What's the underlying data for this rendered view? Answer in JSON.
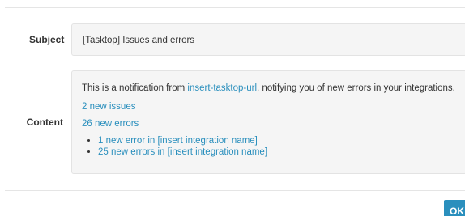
{
  "subject": {
    "label": "Subject",
    "value": "[Tasktop] Issues and errors"
  },
  "content": {
    "label": "Content",
    "intro_prefix": "This is a notification from ",
    "intro_link": "insert-tasktop-url",
    "intro_suffix": ", notifying you of new errors in your integrations.",
    "issues_link": "2 new issues",
    "errors_link": "26 new errors",
    "error_items": [
      "1 new error in [insert integration name]",
      "25 new errors in [insert integration name]"
    ]
  },
  "footer": {
    "ok_label": "OK"
  },
  "colors": {
    "link": "#2a8fbd",
    "button": "#2a8fbd",
    "box_background": "#f5f5f5"
  }
}
